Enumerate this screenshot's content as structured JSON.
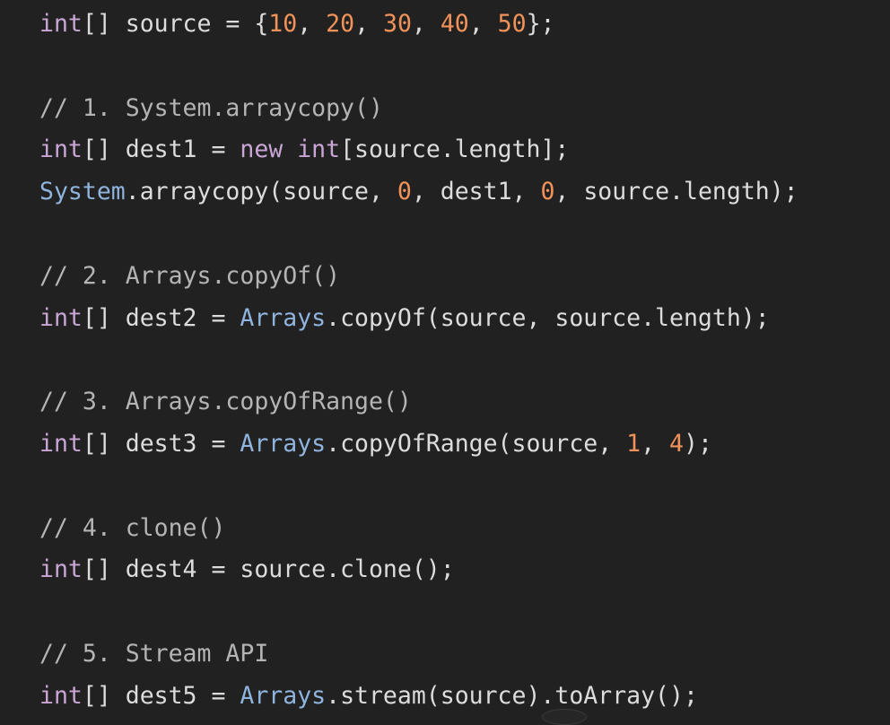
{
  "code": {
    "lines": [
      [
        {
          "t": "int",
          "c": "tok-kw"
        },
        {
          "t": "[] source = {",
          "c": "tok-plain"
        },
        {
          "t": "10",
          "c": "tok-num"
        },
        {
          "t": ", ",
          "c": "tok-plain"
        },
        {
          "t": "20",
          "c": "tok-num"
        },
        {
          "t": ", ",
          "c": "tok-plain"
        },
        {
          "t": "30",
          "c": "tok-num"
        },
        {
          "t": ", ",
          "c": "tok-plain"
        },
        {
          "t": "40",
          "c": "tok-num"
        },
        {
          "t": ", ",
          "c": "tok-plain"
        },
        {
          "t": "50",
          "c": "tok-num"
        },
        {
          "t": "};",
          "c": "tok-plain"
        }
      ],
      [],
      [
        {
          "t": "// 1. System.arraycopy()",
          "c": "tok-cmt"
        }
      ],
      [
        {
          "t": "int",
          "c": "tok-kw"
        },
        {
          "t": "[] dest1 = ",
          "c": "tok-plain"
        },
        {
          "t": "new",
          "c": "tok-kw"
        },
        {
          "t": " ",
          "c": "tok-plain"
        },
        {
          "t": "int",
          "c": "tok-kw"
        },
        {
          "t": "[source.length];",
          "c": "tok-plain"
        }
      ],
      [
        {
          "t": "System",
          "c": "tok-cls"
        },
        {
          "t": ".arraycopy(source, ",
          "c": "tok-plain"
        },
        {
          "t": "0",
          "c": "tok-num"
        },
        {
          "t": ", dest1, ",
          "c": "tok-plain"
        },
        {
          "t": "0",
          "c": "tok-num"
        },
        {
          "t": ", source.length);",
          "c": "tok-plain"
        }
      ],
      [],
      [
        {
          "t": "// 2. Arrays.copyOf()",
          "c": "tok-cmt"
        }
      ],
      [
        {
          "t": "int",
          "c": "tok-kw"
        },
        {
          "t": "[] dest2 = ",
          "c": "tok-plain"
        },
        {
          "t": "Arrays",
          "c": "tok-cls"
        },
        {
          "t": ".copyOf(source, source.length);",
          "c": "tok-plain"
        }
      ],
      [],
      [
        {
          "t": "// 3. Arrays.copyOfRange()",
          "c": "tok-cmt"
        }
      ],
      [
        {
          "t": "int",
          "c": "tok-kw"
        },
        {
          "t": "[] dest3 = ",
          "c": "tok-plain"
        },
        {
          "t": "Arrays",
          "c": "tok-cls"
        },
        {
          "t": ".copyOfRange(source, ",
          "c": "tok-plain"
        },
        {
          "t": "1",
          "c": "tok-num"
        },
        {
          "t": ", ",
          "c": "tok-plain"
        },
        {
          "t": "4",
          "c": "tok-num"
        },
        {
          "t": ");",
          "c": "tok-plain"
        }
      ],
      [],
      [
        {
          "t": "// 4. clone()",
          "c": "tok-cmt"
        }
      ],
      [
        {
          "t": "int",
          "c": "tok-kw"
        },
        {
          "t": "[] dest4 = source.clone();",
          "c": "tok-plain"
        }
      ],
      [],
      [
        {
          "t": "// 5. Stream API",
          "c": "tok-cmt"
        }
      ],
      [
        {
          "t": "int",
          "c": "tok-kw"
        },
        {
          "t": "[] dest5 = ",
          "c": "tok-plain"
        },
        {
          "t": "Arrays",
          "c": "tok-cls"
        },
        {
          "t": ".stream(source).toArray();",
          "c": "tok-plain"
        }
      ]
    ]
  },
  "colors": {
    "background": "#212121",
    "keyword": "#c9a6d6",
    "number": "#f0925a",
    "class": "#8fb4dd",
    "comment": "#b4b4b4",
    "plain": "#dcdcdc"
  }
}
